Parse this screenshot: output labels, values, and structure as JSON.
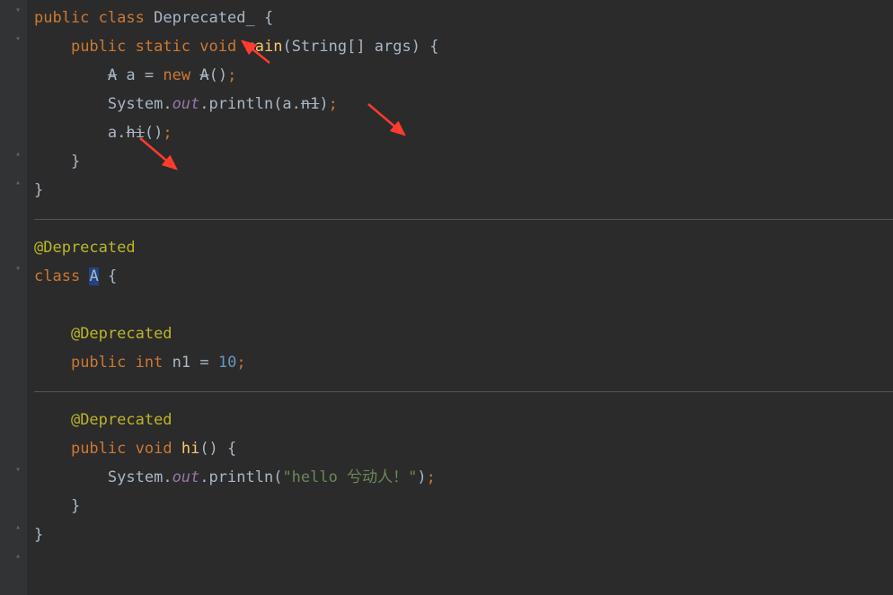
{
  "code": {
    "l1": {
      "kw_public": "public",
      "kw_class": "class",
      "name": "Deprecated_",
      "brace": "{"
    },
    "l2": {
      "kw_public": "public",
      "kw_static": "static",
      "kw_void": "void",
      "method": "main",
      "params": "(String[] args) {"
    },
    "l3": {
      "type": "A",
      "var": "a",
      "eq": "=",
      "kw_new": "new",
      "ctor": "A",
      "rest": "()",
      "semi": ";"
    },
    "l4": {
      "sys": "System",
      "dot1": ".",
      "out": "out",
      "dot2": ".",
      "println": "println",
      "open": "(a.",
      "field": "n1",
      "close": ")",
      "semi": ";"
    },
    "l5": {
      "obj": "a.",
      "method": "hi",
      "rest": "()",
      "semi": ";"
    },
    "l6": {
      "brace": "}"
    },
    "l7": {
      "brace": "}"
    },
    "l8": {
      "ann": "@Deprecated"
    },
    "l9": {
      "kw_class": "class",
      "name": "A",
      "brace": "{"
    },
    "l10": {
      "ann": "@Deprecated"
    },
    "l11": {
      "kw_public": "public",
      "kw_int": "int",
      "var": "n1",
      "eq": "=",
      "val": "10",
      "semi": ";"
    },
    "l12": {
      "ann": "@Deprecated"
    },
    "l13": {
      "kw_public": "public",
      "kw_void": "void",
      "method": "hi",
      "rest": "() {"
    },
    "l14": {
      "sys": "System",
      "dot1": ".",
      "out": "out",
      "dot2": ".",
      "println": "println",
      "open": "(",
      "str": "\"hello 兮动人！\"",
      "close": ")",
      "semi": ";"
    },
    "l15": {
      "brace": "}"
    },
    "l16": {
      "brace": "}"
    }
  },
  "colors": {
    "arrow": "#ff3b30"
  }
}
